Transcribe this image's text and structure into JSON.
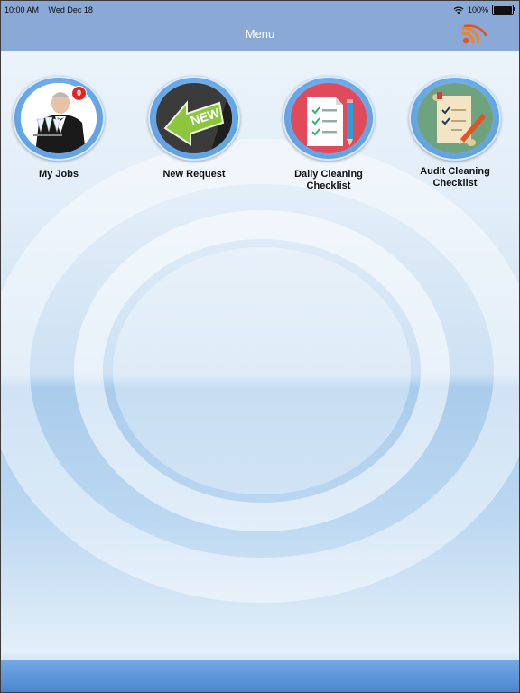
{
  "status": {
    "time": "10:00 AM",
    "date": "Wed Dec 18",
    "battery": "100%",
    "battery_level": 1.0,
    "wifi_icon": "wifi-icon"
  },
  "navbar": {
    "title": "Menu",
    "rss_icon": "rss-icon"
  },
  "menu": {
    "items": [
      {
        "label": "My Jobs",
        "badge": "0",
        "icon": "waiter-icon"
      },
      {
        "label": "New Request",
        "icon": "new-arrow-icon"
      },
      {
        "label": "Daily Cleaning\nChecklist",
        "icon": "checklist-icon"
      },
      {
        "label": "Audit Cleaning\nChecklist",
        "icon": "audit-scroll-icon"
      }
    ]
  },
  "colors": {
    "navbar": "#8aa9d6",
    "accent": "#4d8fd6",
    "badge": "#e02424",
    "rss": "#f5821f"
  }
}
